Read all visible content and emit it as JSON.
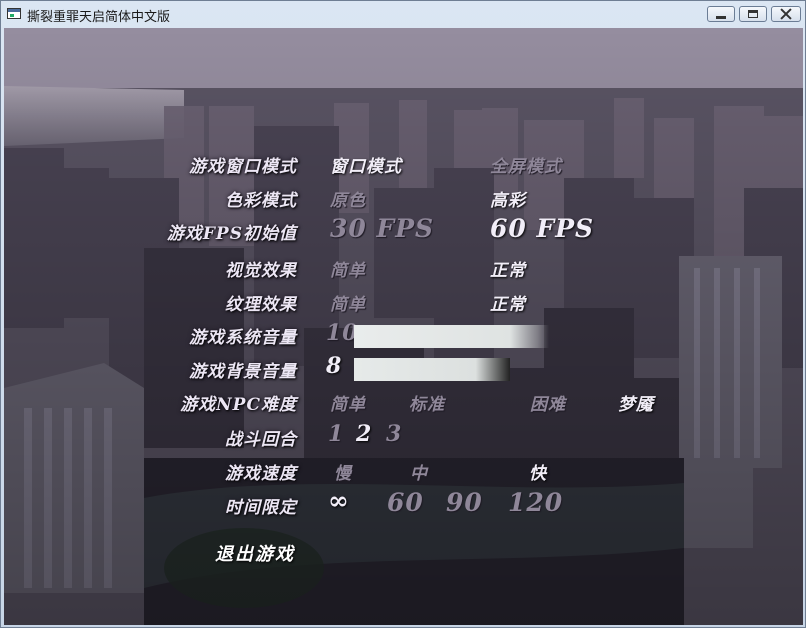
{
  "window": {
    "title": "撕裂重罪天启简体中文版"
  },
  "menu": {
    "window_mode": {
      "label": "游戏窗口模式",
      "options": [
        "窗口模式",
        "全屏模式"
      ]
    },
    "color_mode": {
      "label": "色彩模式",
      "options": [
        "原色",
        "高彩"
      ]
    },
    "fps": {
      "label": "游戏FPS初始值",
      "options": [
        "30 FPS",
        "60 FPS"
      ]
    },
    "visual": {
      "label": "视觉效果",
      "options": [
        "简单",
        "正常"
      ]
    },
    "texture": {
      "label": "纹理效果",
      "options": [
        "简单",
        "正常"
      ]
    },
    "system_volume": {
      "label": "游戏系统音量",
      "value": "10",
      "level": 1.0
    },
    "bg_volume": {
      "label": "游戏背景音量",
      "value": "8",
      "level": 0.8
    },
    "npc_difficulty": {
      "label": "游戏NPC难度",
      "options": [
        "简单",
        "标准",
        "困难",
        "梦魇"
      ]
    },
    "rounds": {
      "label": "战斗回合",
      "options": [
        "1",
        "2",
        "3"
      ]
    },
    "speed": {
      "label": "游戏速度",
      "options": [
        "慢",
        "中",
        "快"
      ]
    },
    "time_limit": {
      "label": "时间限定",
      "options": [
        "∞",
        "60",
        "90",
        "120"
      ]
    },
    "exit_label": "退出游戏"
  }
}
